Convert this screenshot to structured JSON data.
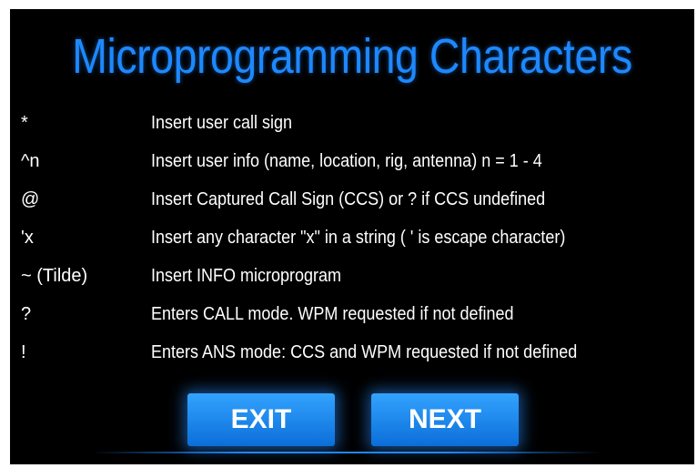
{
  "title": "Microprogramming Characters",
  "rows": [
    {
      "symbol": "*",
      "description": "Insert user call sign"
    },
    {
      "symbol": "^n",
      "description": "Insert user info (name, location, rig, antenna) n = 1 - 4"
    },
    {
      "symbol": "@",
      "description": "Insert Captured Call Sign (CCS) or ? if CCS undefined"
    },
    {
      "symbol": "'x",
      "description": "Insert any character \"x\" in a string ( ' is escape character)"
    },
    {
      "symbol": "~ (Tilde)",
      "description": "Insert INFO microprogram"
    },
    {
      "symbol": "?",
      "description": "Enters CALL mode. WPM requested if not defined"
    },
    {
      "symbol": "!",
      "description": "Enters ANS mode: CCS and WPM requested if not defined"
    }
  ],
  "buttons": {
    "exit_label": "EXIT",
    "next_label": "NEXT"
  },
  "colors": {
    "background": "#000000",
    "accent": "#1e88ff",
    "button": "#1a8cff",
    "text": "#ffffff"
  }
}
